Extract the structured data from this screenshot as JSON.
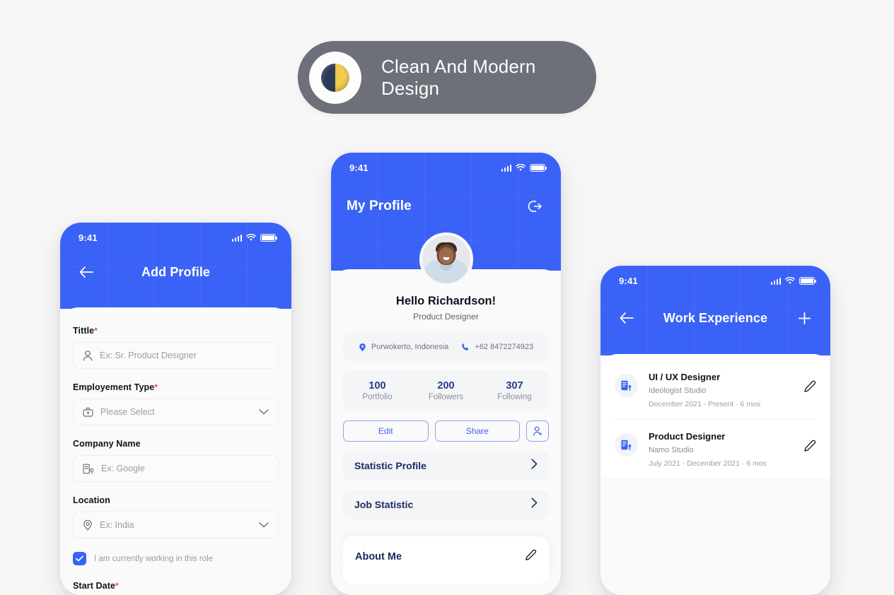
{
  "banner": {
    "icon": "moon-first-quarter-icon",
    "title": "Clean And Modern Design"
  },
  "colors": {
    "primary_blue": "#3B62F6",
    "banner_gray": "#6E7079",
    "page_background": "#F7F7F7",
    "required_red": "#F14B4B",
    "stat_navy": "#253A8C"
  },
  "add_profile_screen": {
    "status_bar": {
      "time": "9:41"
    },
    "nav": {
      "back_icon": "arrow-left-icon",
      "title": "Add Profile"
    },
    "fields": [
      {
        "label": "Tittle",
        "required": true,
        "icon": "person-icon",
        "placeholder": "Ex: Sr. Product Designer",
        "has_chevron": false
      },
      {
        "label": "Employement Type",
        "required": true,
        "icon": "briefcase-icon",
        "placeholder": "Please Select",
        "has_chevron": true
      },
      {
        "label": "Company Name",
        "required": false,
        "icon": "building-icon",
        "placeholder": "Ex: Google",
        "has_chevron": false
      },
      {
        "label": "Location",
        "required": false,
        "icon": "map-pin-icon",
        "placeholder": "Ex: India",
        "has_chevron": true
      }
    ],
    "checkbox": {
      "label": "I am currently working in this role",
      "checked": true
    },
    "last_label": {
      "label": "Start Date",
      "required": true
    }
  },
  "profile_screen": {
    "status_bar": {
      "time": "9:41"
    },
    "nav": {
      "title": "My Profile",
      "action_icon": "logout-icon"
    },
    "avatar": "user-avatar",
    "greeting": "Hello Richardson!",
    "role": "Product Designer",
    "contacts": [
      {
        "icon": "map-pin-filled-icon",
        "text": "Purwokerto, Indonesia"
      },
      {
        "icon": "phone-icon",
        "text": "+62 8472274923"
      }
    ],
    "stats": [
      {
        "value": "100",
        "label": "Portfolio"
      },
      {
        "value": "200",
        "label": "Followers"
      },
      {
        "value": "307",
        "label": "Following"
      }
    ],
    "buttons": {
      "edit": "Edit",
      "share": "Share",
      "add_person_icon": "person-add-icon"
    },
    "links": [
      {
        "label": "Statistic Profile",
        "icon": "chevron-right-icon"
      },
      {
        "label": "Job Statistic",
        "icon": "chevron-right-icon"
      }
    ],
    "about": {
      "title": "About Me",
      "edit_icon": "pencil-icon"
    }
  },
  "work_experience_screen": {
    "status_bar": {
      "time": "9:41"
    },
    "nav": {
      "back_icon": "arrow-left-icon",
      "title": "Work Experience",
      "add_icon": "plus-icon"
    },
    "items": [
      {
        "icon": "building-icon",
        "title": "UI / UX Designer",
        "company": "Ideologist Studio",
        "period": "December 2021 - Present  ·  6 mos",
        "edit_icon": "pencil-icon"
      },
      {
        "icon": "building-icon",
        "title": "Product Designer",
        "company": "Namo Studio",
        "period": "July 2021 - December 2021  ·  6 mos",
        "edit_icon": "pencil-icon"
      }
    ]
  }
}
